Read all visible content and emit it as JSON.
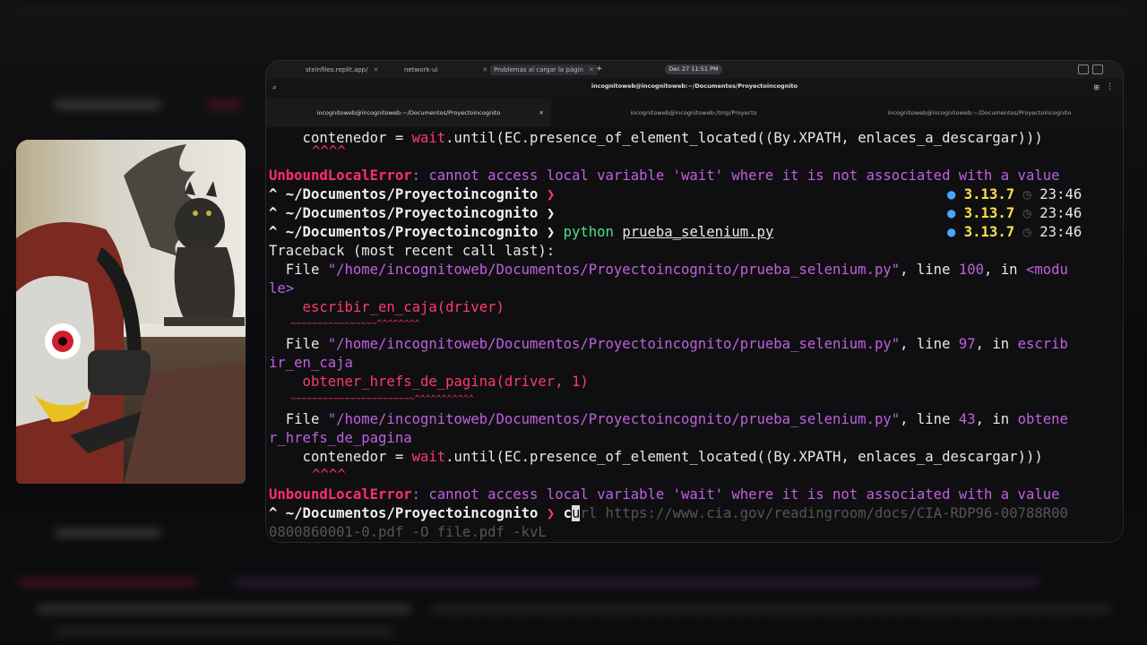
{
  "browser": {
    "tabs": [
      {
        "label": "steinfiles.replit.app/",
        "active": false
      },
      {
        "label": "network-ui",
        "active": false
      },
      {
        "label": "Problemas al cargar la págin",
        "active": true
      }
    ],
    "clock": "Dec 27  11:51 PM"
  },
  "window_title": "incognitoweb@incognitoweb:~/Documentos/Proyectoincognito",
  "terminal_tabs": [
    {
      "label": "incognitoweb@incognitoweb:~/Documentos/Proyectoincognito",
      "active": true
    },
    {
      "label": "incognitoweb@incognitoweb:/tmp/Proyecto",
      "active": false
    },
    {
      "label": "incognitoweb@incognitoweb:~/Documentos/Proyectoincognito",
      "active": false
    }
  ],
  "terminal": {
    "l1_indent": "    contenedor = ",
    "wait": "wait",
    "l1_rest": ".until(EC.presence_of_element_located((By.XPATH, enlaces_a_descargar)))",
    "carets_short": "^^^^",
    "err_name": "UnboundLocalError",
    "err_msg": ": cannot access local variable 'wait' where it is not associated with a value",
    "prompt_arrow": "^ ",
    "prompt_path": "~/Documentos/Proyectoincognito",
    "prompt_chev": " ❯",
    "py_version": "3.13.7",
    "time": "23:46",
    "cmd_python": "python",
    "cmd_file": "prueba_selenium.py",
    "traceback": "Traceback (most recent call last):",
    "file_kw": "  File ",
    "file_path": "\"/home/incognitoweb/Documentos/Proyectoincognito/prueba_selenium.py\"",
    "line_kw": ", line ",
    "in_kw": ", in ",
    "f1_line": "100",
    "f1_func_a": "<modu",
    "f1_func_b": "le>",
    "f1_code": "    escribir_en_caja(driver)",
    "f1_squig": "    ~~~~~~~~~~~~~~~~^^^^^^^^",
    "f2_line": "97",
    "f2_func_a": "escrib",
    "f2_func_b": "ir_en_caja",
    "f2_code": "    obtener_hrefs_de_pagina(driver, 1)",
    "f2_squig": "    ~~~~~~~~~~~~~~~~~~~~~~~^^^^^^^^^^^",
    "f3_line": "43",
    "f3_func_a": "obtene",
    "f3_func_b": "r_hrefs_de_pagina",
    "cmd_c": "c",
    "cmd_u": "u",
    "cmd_rest": "rl",
    "suggest_a": " https://www.cia.gov/readingroom/docs/CIA-RDP96-00788R00",
    "suggest_b": "0800860001-0.pdf -O file.pdf -kvL"
  }
}
